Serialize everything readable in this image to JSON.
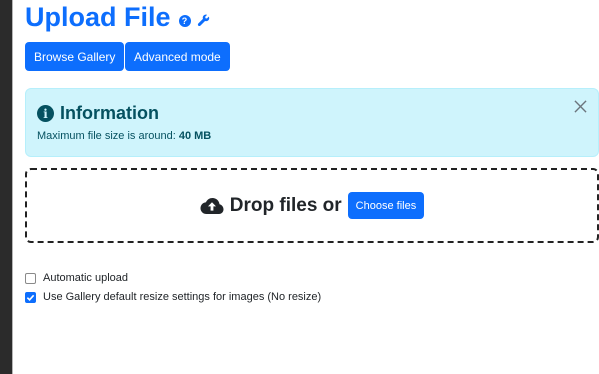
{
  "header": {
    "title": "Upload File",
    "help_icon": "question-circle-icon",
    "settings_icon": "wrench-icon"
  },
  "toolbar": {
    "browse_gallery_label": "Browse Gallery",
    "advanced_mode_label": "Advanced mode"
  },
  "alert": {
    "icon": "info-circle-icon",
    "title": "Information",
    "message_prefix": "Maximum file size is around: ",
    "max_size": "40 MB",
    "close_icon": "close-icon"
  },
  "dropzone": {
    "icon": "cloud-upload-icon",
    "label": "Drop files or",
    "choose_label": "Choose files"
  },
  "options": {
    "automatic_upload": {
      "label": "Automatic upload",
      "checked": false
    },
    "default_resize": {
      "label": "Use Gallery default resize settings for images (No resize)",
      "checked": true
    }
  },
  "colors": {
    "primary": "#0d6efd",
    "alert_bg": "#cff4fc",
    "alert_text": "#055160"
  }
}
